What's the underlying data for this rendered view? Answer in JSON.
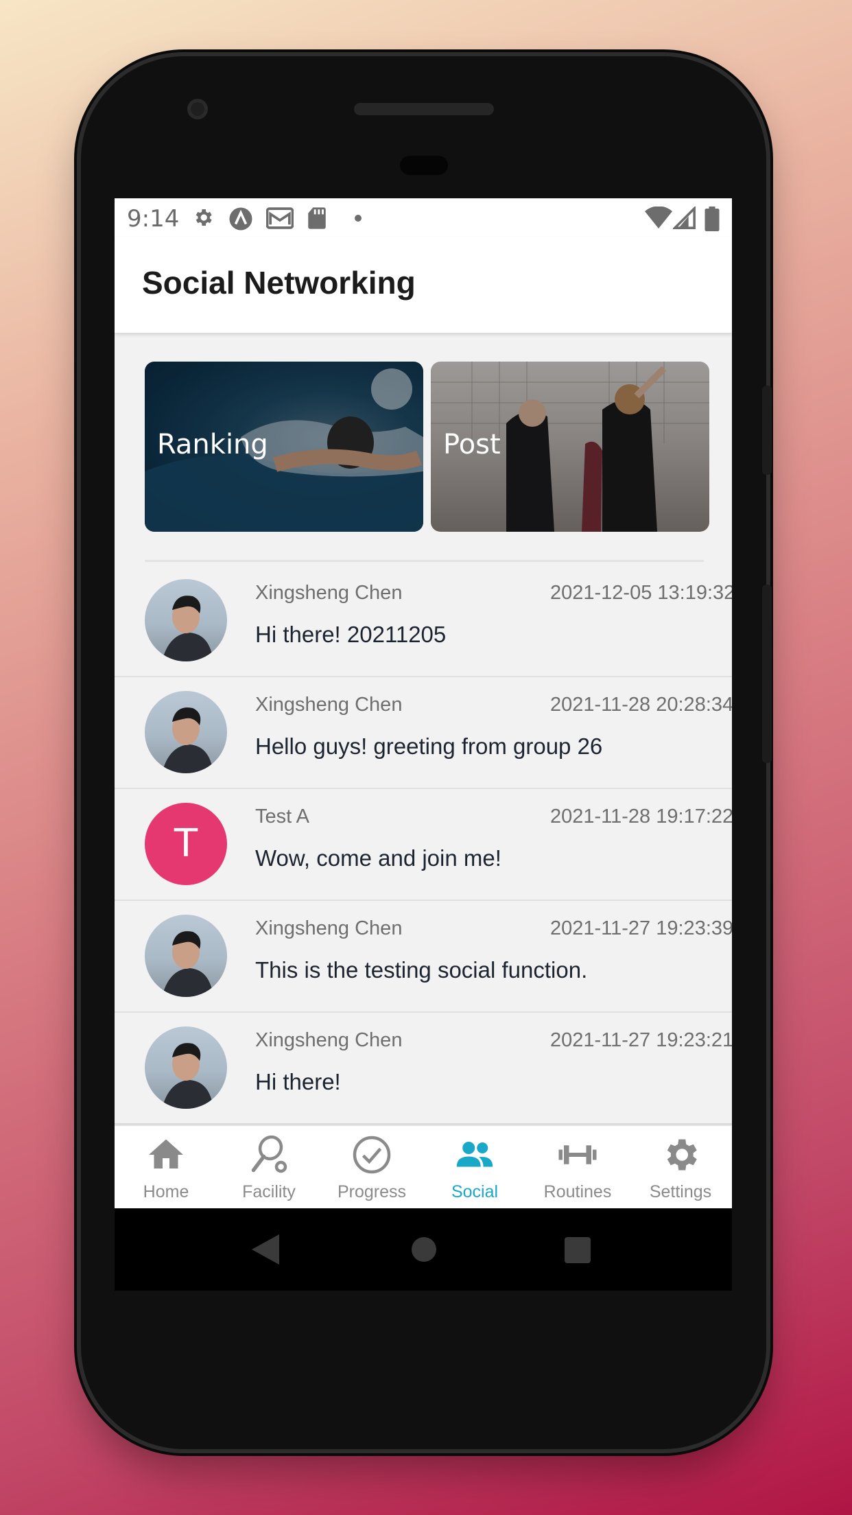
{
  "status_bar": {
    "time": "9:14"
  },
  "app_bar": {
    "title": "Social Networking"
  },
  "cards": [
    {
      "label": "Ranking"
    },
    {
      "label": "Post"
    }
  ],
  "feed": [
    {
      "author": "Xingsheng Chen",
      "time": "2021-12-05 13:19:32",
      "message": "Hi there! 20211205",
      "avatar": "photo"
    },
    {
      "author": "Xingsheng Chen",
      "time": "2021-11-28 20:28:34",
      "message": "Hello guys! greeting from group 26",
      "avatar": "photo"
    },
    {
      "author": "Test A",
      "time": "2021-11-28 19:17:22",
      "message": "Wow, come and join me!",
      "avatar": "T"
    },
    {
      "author": "Xingsheng Chen",
      "time": "2021-11-27 19:23:39",
      "message": "This is the testing social function.",
      "avatar": "photo"
    },
    {
      "author": "Xingsheng Chen",
      "time": "2021-11-27 19:23:21",
      "message": "Hi there!",
      "avatar": "photo"
    }
  ],
  "bottom_nav": {
    "items": [
      {
        "label": "Home",
        "icon": "home-icon"
      },
      {
        "label": "Facility",
        "icon": "facility-icon"
      },
      {
        "label": "Progress",
        "icon": "check-circle-icon"
      },
      {
        "label": "Social",
        "icon": "people-icon",
        "active": true
      },
      {
        "label": "Routines",
        "icon": "dumbbell-icon"
      },
      {
        "label": "Settings",
        "icon": "gear-icon"
      }
    ]
  },
  "colors": {
    "accent": "#1aa8c9",
    "avatar_t": "#e63870",
    "inactive": "#8a8a8a"
  }
}
